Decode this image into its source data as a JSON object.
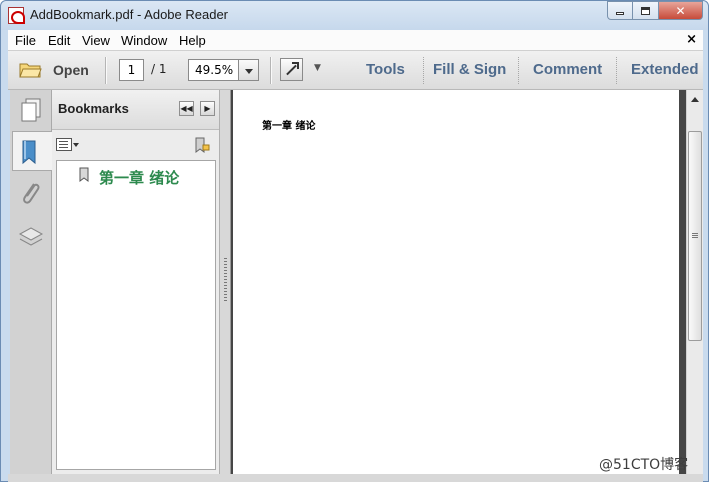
{
  "window": {
    "title": "AddBookmark.pdf - Adobe Reader",
    "buttons": {
      "minimize": "minimize",
      "maximize": "maximize",
      "close": "✕"
    }
  },
  "menu": {
    "items": [
      "File",
      "Edit",
      "View",
      "Window",
      "Help"
    ],
    "close_glyph": "×"
  },
  "toolbar": {
    "open_label": "Open",
    "page_current": "1",
    "page_total": "/ 1",
    "zoom": "49.5%",
    "more_glyph": "▼",
    "links": [
      "Tools",
      "Fill & Sign",
      "Comment",
      "Extended"
    ]
  },
  "panel": {
    "title": "Bookmarks",
    "collapse_glyph": "◀◀",
    "expand_glyph": "▶",
    "bookmarks": [
      {
        "label": "第一章 绪论"
      }
    ]
  },
  "document": {
    "page_text": "第一章 绪论"
  },
  "watermark": "@51CTO博客",
  "icons": {
    "rail": [
      "pages-icon",
      "bookmark-icon",
      "attachment-icon",
      "layers-icon"
    ],
    "panel": [
      "options-icon",
      "new-bookmark-icon",
      "bookmark-item-icon"
    ]
  },
  "colors": {
    "bookmark_text": "#2d8a4e",
    "toolbar_links": "#4e6a8c"
  }
}
